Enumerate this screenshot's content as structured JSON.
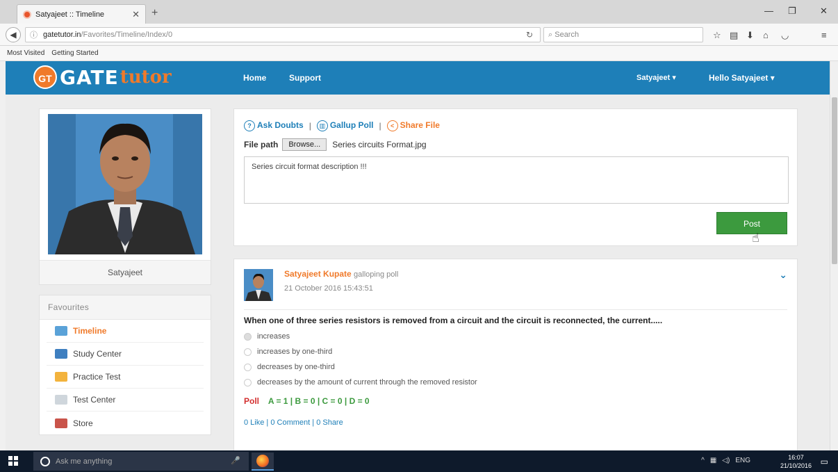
{
  "browser": {
    "tab_title": "Satyajeet :: Timeline",
    "url_host": "gatetutor.in",
    "url_path": "/Favorites/Timeline/Index/0",
    "search_placeholder": "Search",
    "bookmarks": [
      "Most Visited",
      "Getting Started"
    ]
  },
  "site": {
    "logo_badge": "GT",
    "logo_main": "GATE",
    "logo_accent": "tutor",
    "nav": [
      "Home",
      "Support"
    ],
    "user_menu": "Satyajeet ▾",
    "hello_menu": "Hello Satyajeet ▾",
    "colors": {
      "header": "#1e7fb8",
      "accent": "#f07a2a",
      "post_button": "#3c9a3e"
    }
  },
  "profile": {
    "name": "Satyajeet"
  },
  "favourites": {
    "heading": "Favourites",
    "items": [
      {
        "label": "Timeline",
        "icon": "timeline-icon"
      },
      {
        "label": "Study Center",
        "icon": "study-center-icon"
      },
      {
        "label": "Practice Test",
        "icon": "practice-test-icon"
      },
      {
        "label": "Test Center",
        "icon": "test-center-icon"
      },
      {
        "label": "Store",
        "icon": "store-icon"
      }
    ]
  },
  "composer": {
    "ask_doubts": "Ask Doubts",
    "gallup_poll": "Gallup Poll",
    "share_file": "Share File",
    "file_path_label": "File path",
    "browse_label": "Browse...",
    "file_name": "Series circuits Format.jpg",
    "description": "Series circuit format description !!!",
    "post_label": "Post"
  },
  "feed": {
    "author": "Satyajeet Kupate",
    "post_type": "galloping poll",
    "date": "21 October 2016 15:43:51",
    "question": "When one of three series resistors is removed from a circuit and the circuit is reconnected, the current.....",
    "options": [
      "increases",
      "increases by one-third",
      "decreases by one-third",
      "decreases by the amount of current through the removed resistor"
    ],
    "poll_label": "Poll",
    "poll_results": "A = 1  |  B = 0  |  C = 0  |  D = 0",
    "like": "0 Like",
    "comment": "0 Comment",
    "share": "0 Share"
  },
  "taskbar": {
    "search_placeholder": "Ask me anything",
    "lang": "ENG",
    "time": "16:07",
    "date": "21/10/2016"
  }
}
